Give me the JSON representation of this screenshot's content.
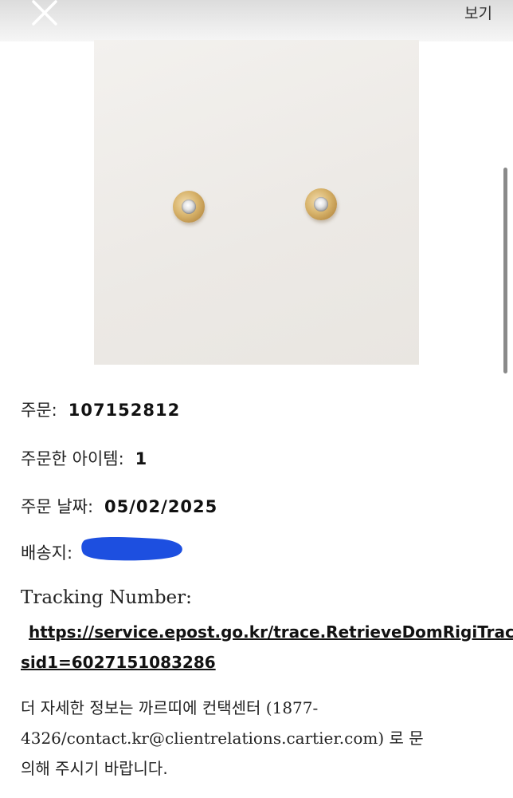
{
  "header": {
    "close_icon": "close-icon",
    "view_label": "보기"
  },
  "product": {
    "image_alt": "earrings-image"
  },
  "order": {
    "order_label": "주문:",
    "order_number": "107152812",
    "items_label": "주문한 아이템:",
    "items_count": "1",
    "date_label": "주문 날짜:",
    "date_value": "05/02/2025",
    "shipping_label": "배송지:"
  },
  "tracking": {
    "label": "Tracking Number:",
    "link_line1": "https://service.epost.go.kr/trace.RetrieveDomRigiTraceList.comm?",
    "link_line2": "sid1=6027151083286"
  },
  "contact": {
    "line1_ko": "더 자세한 정보는 까르띠에 컨택센터",
    "line1_rest": " (1877-",
    "line2_start": "4326/contact.kr@clientrelations.cartier.com)",
    "line2_ko": " 로 문",
    "line3_ko": "의해 주시기 바랍니다."
  },
  "colors": {
    "redaction": "#1d4fe0",
    "text": "#111111",
    "topbar": "#e6e6e6"
  }
}
